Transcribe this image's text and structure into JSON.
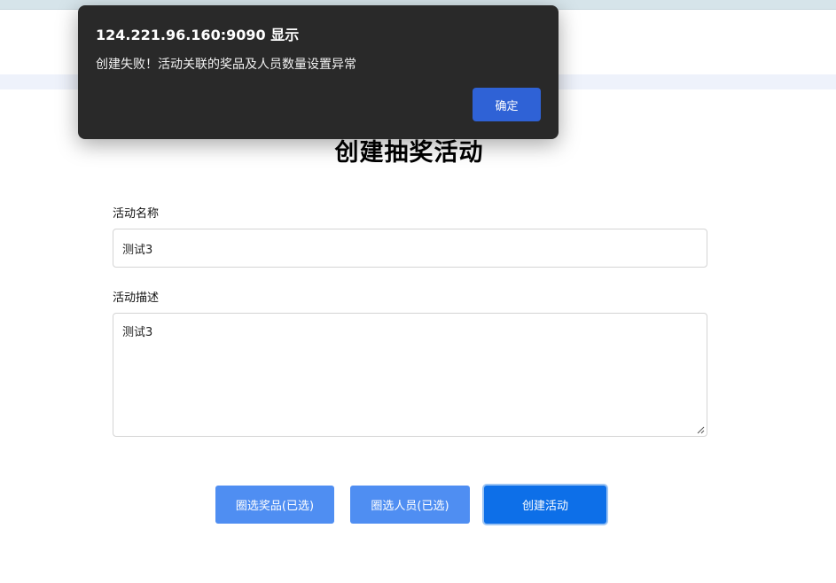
{
  "form": {
    "title": "创建抽奖活动",
    "name_label": "活动名称",
    "name_value": "测试3",
    "desc_label": "活动描述",
    "desc_value": "测试3"
  },
  "actions": {
    "select_prizes_label": "圈选奖品(已选)",
    "select_people_label": "圈选人员(已选)",
    "create_label": "创建活动"
  },
  "dialog": {
    "origin": "124.221.96.160:9090 显示",
    "message": "创建失败！活动关联的奖品及人员数量设置异常",
    "ok_label": "确定"
  },
  "colors": {
    "secondary_button": "#4f8ef2",
    "primary_button": "#0d6fe8",
    "dialog_bg": "#292929",
    "dialog_button": "#2f62d6"
  }
}
